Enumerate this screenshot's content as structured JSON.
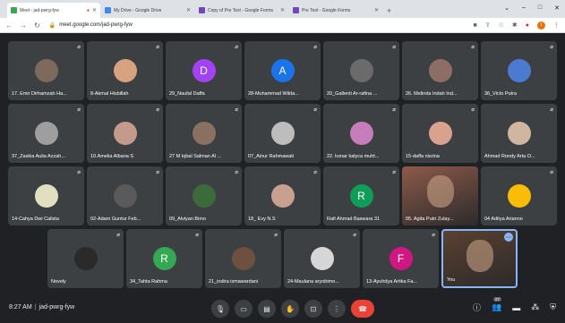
{
  "browser": {
    "tabs": [
      {
        "title": "Meet - jad-pwrg-fyw",
        "active": true,
        "favicon_color": "#34a853",
        "recording": true
      },
      {
        "title": "My Drive - Google Drive",
        "active": false,
        "favicon_color": "#4285f4"
      },
      {
        "title": "Copy of Pre Test - Google Forms",
        "active": false,
        "favicon_color": "#7248b9"
      },
      {
        "title": "Pre Test - Google Forms",
        "active": false,
        "favicon_color": "#7248b9"
      }
    ],
    "new_tab": "+",
    "window_controls": [
      "⌄",
      "–",
      "□",
      "✕"
    ],
    "url": "meet.google.com/jad-pwrg-fyw",
    "profile_initial": "I"
  },
  "participants": [
    {
      "name": "17. Emir Dirhamzah Ha...",
      "avatar_color": "#7d6a5b",
      "kind": "photo"
    },
    {
      "name": "8-Akmal Hisbillah",
      "avatar_color": "#d7a27e",
      "kind": "photo"
    },
    {
      "name": "29_Naufal Daffa",
      "avatar_color": "#a142f4",
      "kind": "initial",
      "initial": "D"
    },
    {
      "name": "28-Muhammad Wilda...",
      "avatar_color": "#1a73e8",
      "kind": "initial",
      "initial": "A"
    },
    {
      "name": "20_Gallenti Ar-rafina ...",
      "avatar_color": "#6b6b6b",
      "kind": "photo"
    },
    {
      "name": "26. Melinda Indah Ind...",
      "avatar_color": "#8d6e63",
      "kind": "photo"
    },
    {
      "name": "36_Victo Putra",
      "avatar_color": "#4a7bd0",
      "kind": "photo"
    },
    {
      "name": "37_Zaskia Aulia Azzah...",
      "avatar_color": "#9e9e9e",
      "kind": "photo"
    },
    {
      "name": "10.Amelia Albana S",
      "avatar_color": "#c49a8a",
      "kind": "photo"
    },
    {
      "name": "27 M Iqbal Salman Al ...",
      "avatar_color": "#8a7060",
      "kind": "photo"
    },
    {
      "name": "07_Ainur Rahmawati",
      "avatar_color": "#bdbdbd",
      "kind": "photo"
    },
    {
      "name": "22. konar kalyca muht...",
      "avatar_color": "#c77dbb",
      "kind": "photo"
    },
    {
      "name": "15-daffa nisrina",
      "avatar_color": "#d9a28f",
      "kind": "photo"
    },
    {
      "name": "Ahmad Rondy Arta O...",
      "avatar_color": "#d0b6a0",
      "kind": "photo"
    },
    {
      "name": "14-Cahya Dwi Calista",
      "avatar_color": "#e0e0c0",
      "kind": "photo"
    },
    {
      "name": "02-Adam Guntur Feb...",
      "avatar_color": "#5a5a5a",
      "kind": "photo"
    },
    {
      "name": "09_Alviyan Bimo",
      "avatar_color": "#3b6b3b",
      "kind": "photo"
    },
    {
      "name": "18_ Evy N.S",
      "avatar_color": "#c8a090",
      "kind": "photo"
    },
    {
      "name": "Rafi Ahmad Baswara 31",
      "avatar_color": "#0f9d58",
      "kind": "initial",
      "initial": "R"
    },
    {
      "name": "05. Agita Putri Zulay...",
      "avatar_color": "#8d5a4a",
      "kind": "video"
    },
    {
      "name": "04 Aditya Arianno",
      "avatar_color": "#fbbc04",
      "kind": "photo"
    },
    {
      "name": "Novely",
      "avatar_color": "#2a2a2a",
      "kind": "photo"
    },
    {
      "name": "34_Tahta Rahma",
      "avatar_color": "#34a853",
      "kind": "initial",
      "initial": "R"
    },
    {
      "name": "21_indira ismawardani",
      "avatar_color": "#6d5040",
      "kind": "photo"
    },
    {
      "name": "24-Maulana aryobimo...",
      "avatar_color": "#d6d6d6",
      "kind": "photo"
    },
    {
      "name": "13-Ayuhdya Artika Fa...",
      "avatar_color": "#d01884",
      "kind": "initial",
      "initial": "F"
    },
    {
      "name": "You",
      "avatar_color": "#5a4030",
      "kind": "self"
    }
  ],
  "meeting": {
    "time": "8:27 AM",
    "separator": "|",
    "code": "jad-pwrg-fyw",
    "participant_count": "27"
  },
  "icons": {
    "mic_off": "mic-off-icon",
    "mic": "microphone-icon",
    "camera": "camera-icon",
    "captions": "captions-icon",
    "raise_hand": "raise-hand-icon",
    "present": "present-screen-icon",
    "more": "more-options-icon",
    "end_call": "end-call-icon",
    "info": "info-icon",
    "people": "people-icon",
    "chat": "chat-icon",
    "activities": "activities-icon",
    "host_controls": "host-controls-icon"
  }
}
